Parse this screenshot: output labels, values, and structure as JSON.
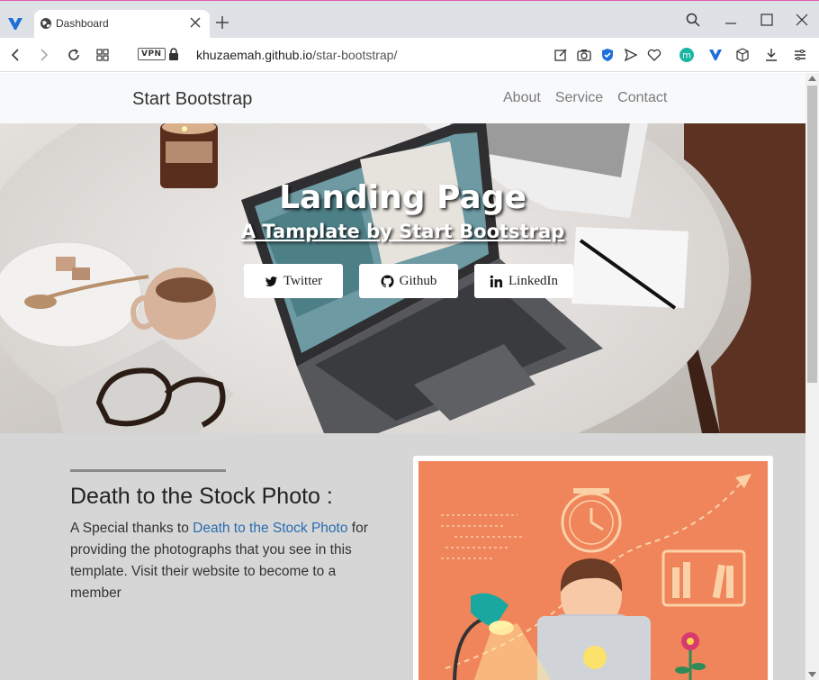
{
  "browser": {
    "tab_title": "Dashboard",
    "url_host": "khuzaemah.github.io",
    "url_path": "/star-bootstrap/",
    "vpn_label": "VPN"
  },
  "navbar": {
    "brand": "Start Bootstrap",
    "links": [
      "About",
      "Service",
      "Contact"
    ]
  },
  "hero": {
    "title": "Landing Page",
    "subtitle": "A Tamplate by Start Bootstrap",
    "buttons": [
      "Twitter",
      "Github",
      "LinkedIn"
    ]
  },
  "section": {
    "title": "Death to the Stock Photo :",
    "text_before": "A Special thanks to ",
    "link_text": "Death to the Stock Photo",
    "text_after": " for providing the photographs that you see in this template. Visit their website to become to a member"
  },
  "colors": {
    "illustration_bg": "#f0845a",
    "link": "#2b6cb0",
    "navbar_bg": "#f8f9fa",
    "content_bg": "#d6d6d6"
  }
}
